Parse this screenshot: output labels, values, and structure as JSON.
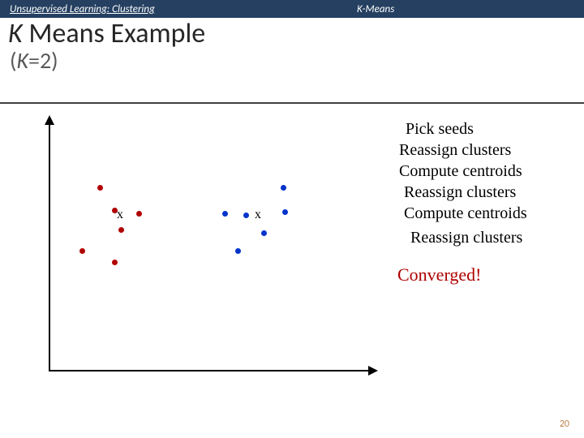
{
  "header": {
    "breadcrumb_left": "Unsupervised Learning: Clustering",
    "breadcrumb_right": "K-Means"
  },
  "title": {
    "k_glyph": "K",
    "main_rest": " Means Example",
    "sub_open": "(",
    "sub_k": "K",
    "sub_rest": "=2)"
  },
  "steps": {
    "s1": "Pick seeds",
    "s2": "Reassign clusters",
    "s3": "Compute centroids",
    "s4": "Reassign clusters",
    "s5": "Compute centroids",
    "s6": "Reassign clusters",
    "s7": "Converged!"
  },
  "centroids": {
    "c1_label": "x",
    "c2_label": "x"
  },
  "page_number": "20",
  "chart_data": {
    "type": "scatter",
    "title": "K Means Example (K=2)",
    "xlabel": "",
    "ylabel": "",
    "xlim": [
      0,
      10
    ],
    "ylim": [
      0,
      10
    ],
    "series": [
      {
        "name": "cluster-1-red",
        "x": [
          1.6,
          2.0,
          2.8,
          2.2,
          1.0,
          2.0
        ],
        "y": [
          7.0,
          6.2,
          6.1,
          5.6,
          4.9,
          4.6
        ]
      },
      {
        "name": "cluster-2-blue",
        "x": [
          5.4,
          6.0,
          6.8,
          6.2,
          5.7,
          7.2
        ],
        "y": [
          6.1,
          6.0,
          6.2,
          5.4,
          4.8,
          7.0
        ]
      }
    ],
    "centroids": [
      {
        "name": "centroid-1",
        "x": 2.2,
        "y": 5.9
      },
      {
        "name": "centroid-2",
        "x": 6.3,
        "y": 5.9
      }
    ]
  }
}
